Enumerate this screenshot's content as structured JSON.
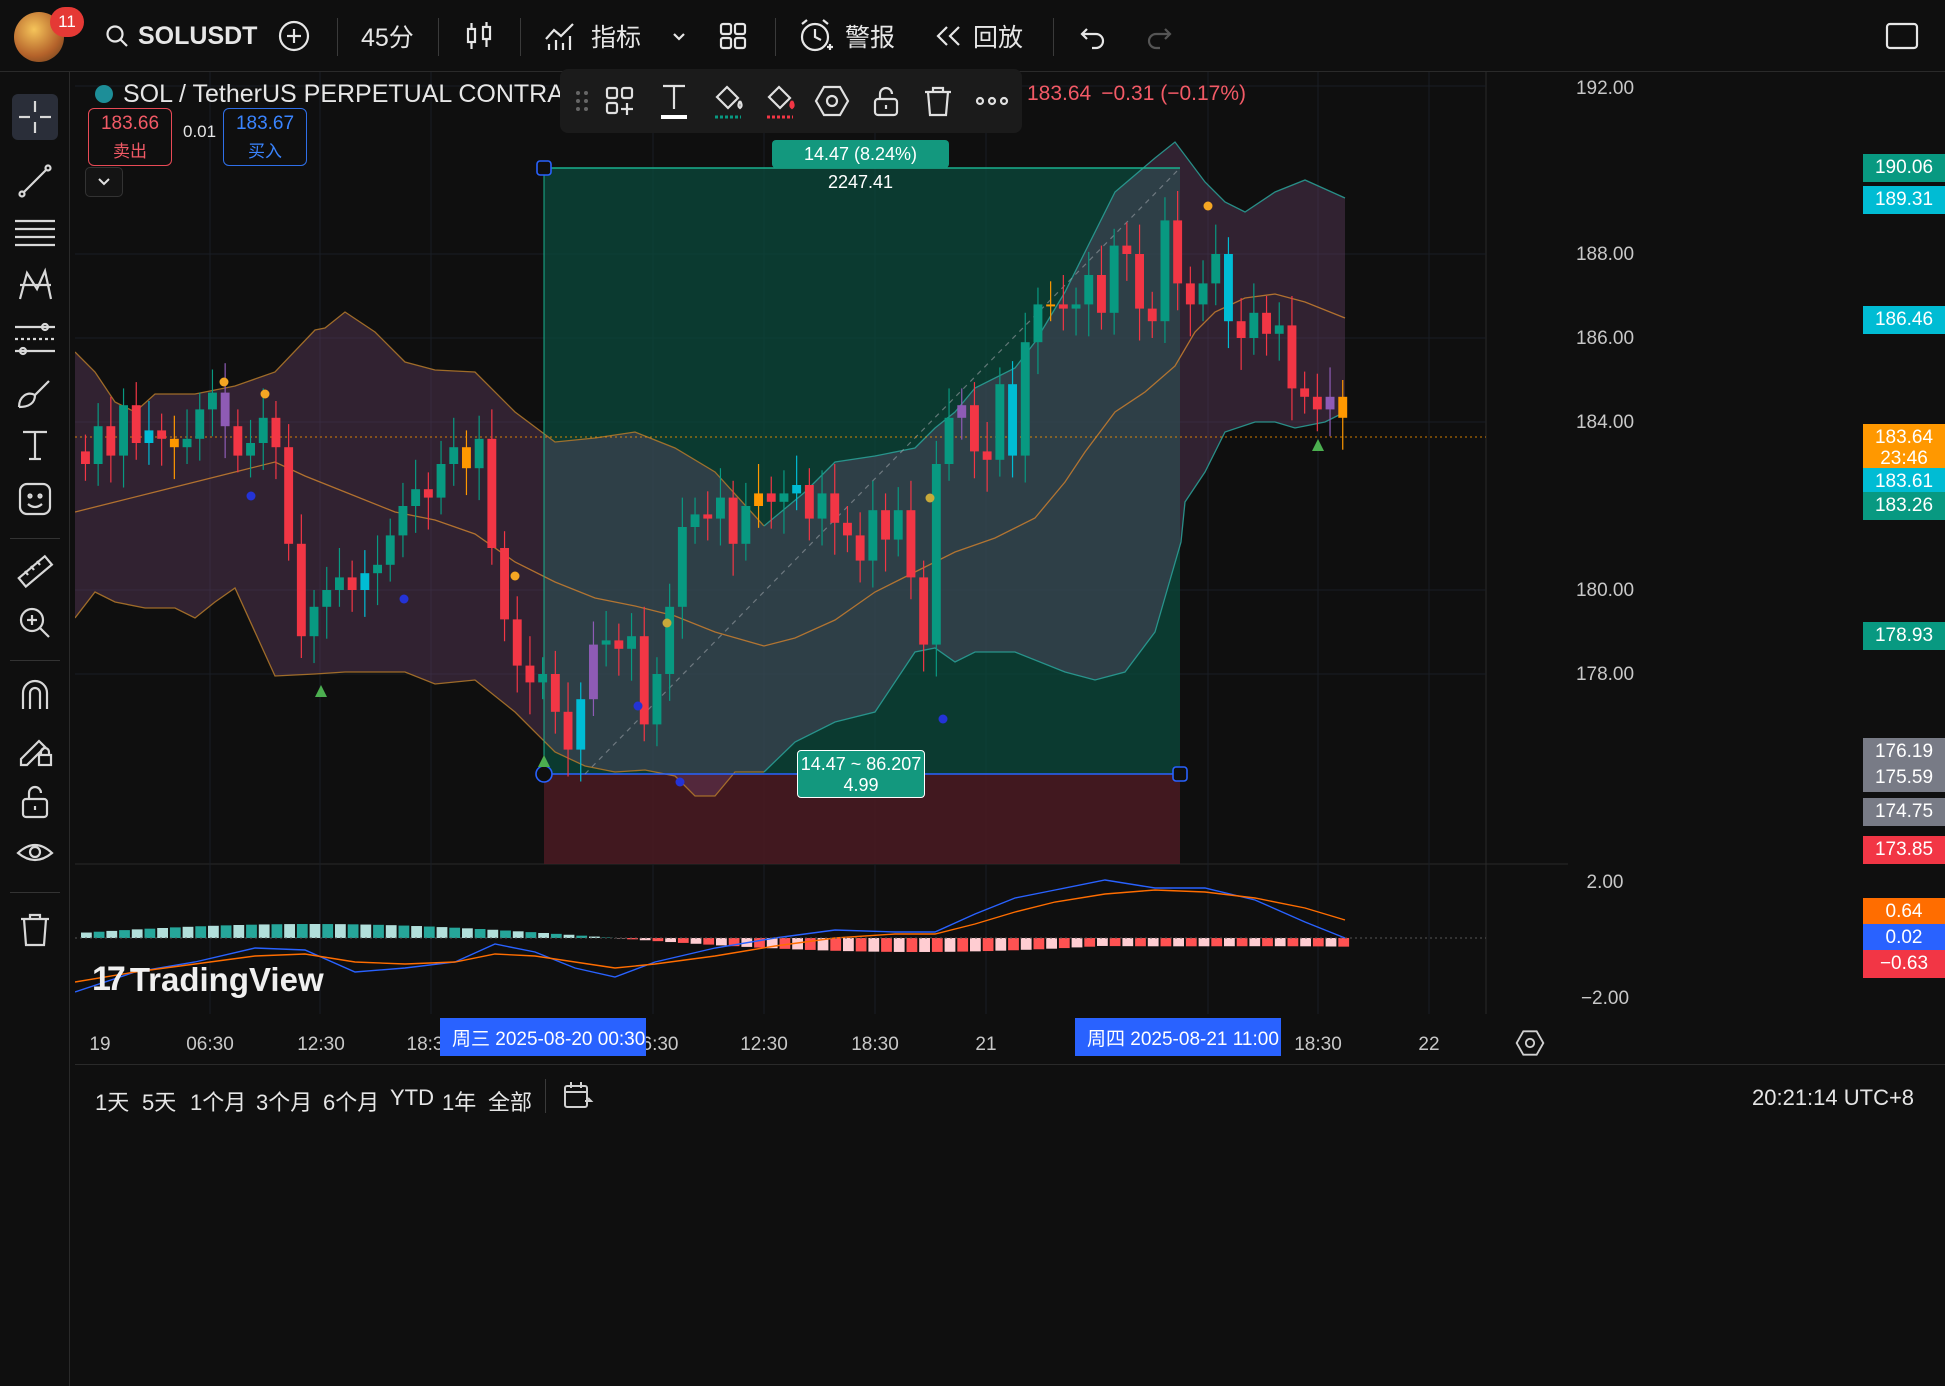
{
  "topbar": {
    "notification_count": "11",
    "symbol": "SOLUSDT",
    "interval": "45分",
    "indicators_label": "指标",
    "alerts_label": "警报",
    "replay_label": "回放"
  },
  "legend": {
    "symbol_title": "SOL / TetherUS PERPETUAL CONTRACT · 45 ·",
    "close_tail": "183.64",
    "change": "−0.31 (−0.17%)",
    "sell_price": "183.66",
    "sell_label": "卖出",
    "spread": "0.01",
    "buy_price": "183.67",
    "buy_label": "买入"
  },
  "measure": {
    "top_label": "14.47 (8.24%) 2247.41",
    "bottom_line1": "14.47 ~ 86.207",
    "bottom_line2": "4.99"
  },
  "price_axis": {
    "ticks": [
      "192.00",
      "188.00",
      "186.00",
      "184.00",
      "180.00",
      "178.00"
    ],
    "labels": [
      {
        "text": "190.06",
        "color": "#089981"
      },
      {
        "text": "189.31",
        "color": "#00bcd4"
      },
      {
        "text": "186.46",
        "color": "#00bcd4"
      },
      {
        "text": "183.64",
        "color": "#ff9800"
      },
      {
        "text": "23:46",
        "color": "#ff9800"
      },
      {
        "text": "183.61",
        "color": "#00bcd4"
      },
      {
        "text": "183.26",
        "color": "#089981"
      },
      {
        "text": "178.93",
        "color": "#089981"
      },
      {
        "text": "176.19",
        "color": "#787b86"
      },
      {
        "text": "175.59",
        "color": "#787b86"
      },
      {
        "text": "174.75",
        "color": "#787b86"
      },
      {
        "text": "173.85",
        "color": "#f23645"
      }
    ]
  },
  "macd_axis": {
    "ticks": [
      "2.00",
      "−2.00"
    ],
    "labels": [
      {
        "text": "0.64",
        "color": "#ff6d00"
      },
      {
        "text": "0.02",
        "color": "#2962ff"
      },
      {
        "text": "−0.63",
        "color": "#f23645"
      }
    ]
  },
  "time_axis": {
    "ticks": [
      "19",
      "06:30",
      "12:30",
      "18:3",
      "6:30",
      "12:30",
      "18:30",
      "21",
      "18:30",
      "22"
    ],
    "highlight_start": "周三 2025-08-20   00:30",
    "highlight_end": "周四 2025-08-21   11:00"
  },
  "ranges": [
    "1天",
    "5天",
    "1个月",
    "3个月",
    "6个月",
    "YTD",
    "1年",
    "全部"
  ],
  "clock": "20:21:14 UTC+8",
  "watermark": "TradingView",
  "colors": {
    "up": "#089981",
    "down": "#f23645",
    "cyan": "#00bcd4",
    "orange": "#ff9800",
    "purple": "#8e5bb5",
    "blue": "#2962ff"
  }
}
